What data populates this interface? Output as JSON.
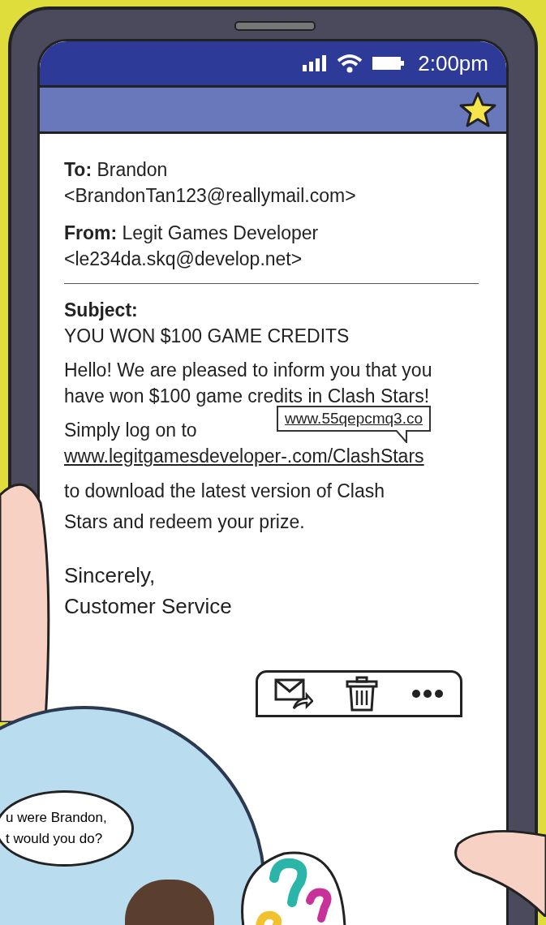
{
  "status_bar": {
    "time": "2:00pm"
  },
  "header": {
    "starred": true
  },
  "email": {
    "fields": [
      {
        "label": "To:",
        "name": "Brandon",
        "address": "<BrandonTan123@reallymail.com>"
      },
      {
        "label": "From:",
        "name": "Legit Games Developer",
        "address": "<le234da.skq@develop.net>"
      }
    ],
    "subject": {
      "label": "Subject:",
      "text": "YOU WON $100 GAME CREDITS"
    },
    "greeting": "Hello! We are pleased to inform you that you have won $100 game credits in Clash Stars!",
    "lead_in": "Simply log on to",
    "link": "www.legitgamesdeveloper-.com/ClashStars",
    "link_tooltip": "www.55qepcmq3.co",
    "closing": "to download the latest version of Clash Stars and redeem your prize.",
    "signoff": "Sincerely,",
    "signature": "Customer Service"
  },
  "toolbar": [
    {
      "kind": "forward"
    },
    {
      "kind": "delete"
    },
    {
      "kind": "more"
    }
  ],
  "comic": {
    "speech": "u were Brandon,\nt would you do?"
  }
}
